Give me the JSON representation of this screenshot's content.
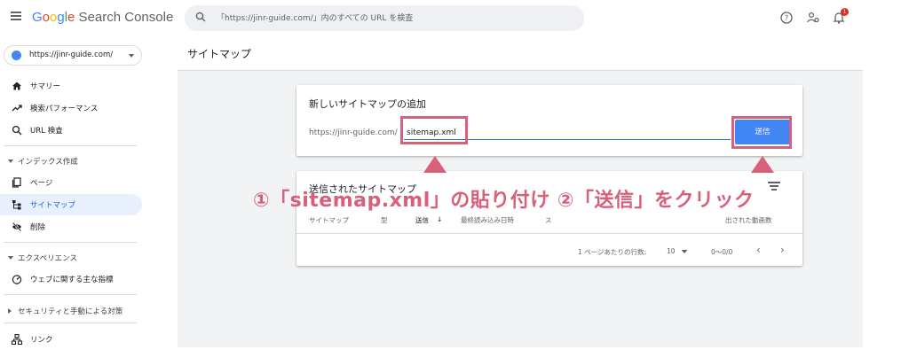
{
  "app": {
    "logo": {
      "G": "G",
      "o1": "o",
      "o2": "o",
      "g": "g",
      "l": "l",
      "e": "e",
      "product": " Search Console"
    }
  },
  "search": {
    "placeholder": "「https://jinr-guide.com/」内のすべての URL を検査"
  },
  "topbar": {
    "notification_count": "1"
  },
  "property": {
    "label": "https://jinr-guide.com/"
  },
  "sidebar": {
    "items": [
      {
        "label": "サマリー"
      },
      {
        "label": "検索パフォーマンス"
      },
      {
        "label": "URL 検査"
      }
    ],
    "index_section": {
      "label": "インデックス作成"
    },
    "index_items": [
      {
        "label": "ページ"
      },
      {
        "label": "サイトマップ"
      },
      {
        "label": "削除"
      }
    ],
    "experience_section": {
      "label": "エクスペリエンス"
    },
    "experience_items": [
      {
        "label": "ウェブに関する主な指標"
      }
    ],
    "security_section": {
      "label": "セキュリティと手動による対策"
    },
    "links": {
      "label": "リンク"
    }
  },
  "main": {
    "title": "サイトマップ",
    "add_card": {
      "title": "新しいサイトマップの追加",
      "prefix": "https://jinr-guide.com/",
      "value": "sitemap.xml",
      "submit_label": "送信"
    },
    "submitted_card": {
      "title": "送信されたサイトマップ",
      "columns": [
        "サイトマップ",
        "型",
        "送信",
        "最終読み込み日時",
        "ス",
        "出された動画数"
      ],
      "sort_arrow": "↓",
      "rows_per_page_label": "1 ページあたりの行数:",
      "rows_per_page": "10",
      "range": "0〜0/0",
      "prev": "‹",
      "next": "›"
    }
  },
  "annotation": {
    "text": "①「sitemap.xml」の貼り付け ②「送信」をクリック",
    "color": "#d9607a"
  }
}
